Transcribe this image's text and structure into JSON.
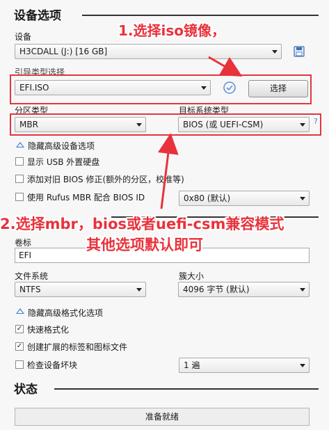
{
  "device_section": {
    "title": "设备选项",
    "device_label": "设备",
    "device_value": "H3CDALL (J:) [16 GB]",
    "boot_type_label": "引导类型选择",
    "boot_type_value": "EFI.ISO",
    "select_button": "选择",
    "partition_label": "分区类型",
    "partition_value": "MBR",
    "target_label": "目标系统类型",
    "target_value": "BIOS (或 UEFI-CSM)",
    "help_mark": "?",
    "advanced_toggle": "隐藏高级设备选项",
    "checkboxes": [
      {
        "label": "显示 USB 外置硬盘",
        "checked": false
      },
      {
        "label": "添加对旧 BIOS 修正(额外的分区，校准等)",
        "checked": false
      },
      {
        "label": "使用 Rufus MBR 配合 BIOS ID",
        "checked": false
      }
    ],
    "bios_id_value": "0x80 (默认)"
  },
  "format_section": {
    "volume_label": "卷标",
    "volume_value": "EFI",
    "fs_label": "文件系统",
    "fs_value": "NTFS",
    "cluster_label": "簇大小",
    "cluster_value": "4096 字节 (默认)",
    "advanced_toggle": "隐藏高级格式化选项",
    "checkboxes": [
      {
        "label": "快速格式化",
        "checked": true
      },
      {
        "label": "创建扩展的标签和图标文件",
        "checked": true
      },
      {
        "label": "检查设备坏块",
        "checked": false
      }
    ],
    "passes_value": "1 遍"
  },
  "status_section": {
    "title": "状态",
    "status_text": "准备就绪"
  },
  "annotations": {
    "note1": "1.选择iso镜像，",
    "note2_line1": "2.选择mbr，bios或者uefi-csm兼容模式",
    "note2_line2": "其他选项默认即可"
  },
  "colors": {
    "annotation_red": "#e8323c",
    "toggle_blue": "#3a7bd5"
  },
  "icons": [
    "save-icon",
    "check-circle-icon",
    "dropdown-arrow-icon",
    "checkbox-icon",
    "collapse-triangle-icon",
    "red-arrow-icon"
  ]
}
